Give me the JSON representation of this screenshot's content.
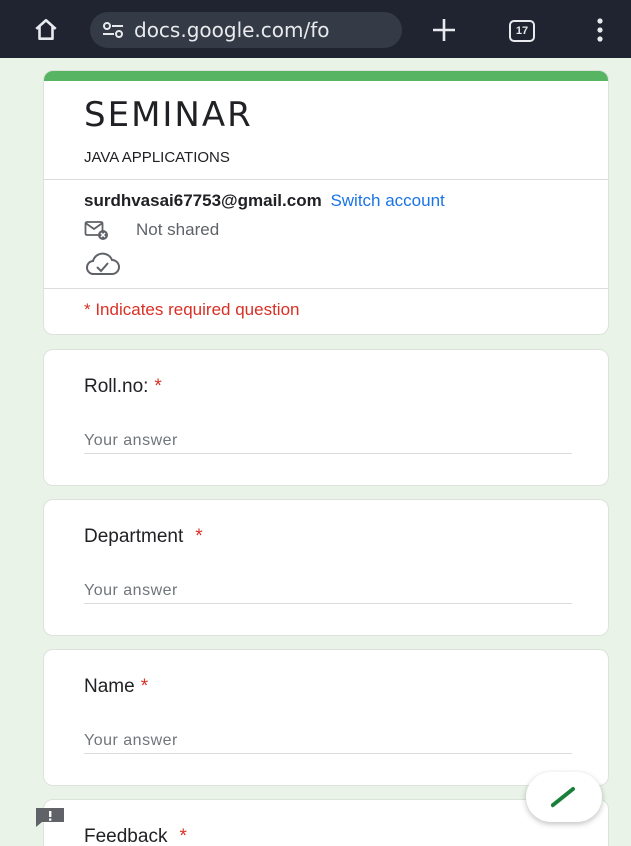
{
  "browser": {
    "url": "docs.google.com/fo",
    "tab_count": "17"
  },
  "form": {
    "title": "SEMINAR",
    "description": "JAVA APPLICATIONS",
    "account_email": "surdhvasai67753@gmail.com",
    "switch_account": "Switch account",
    "shared_status": "Not shared",
    "required_note": "* Indicates required question",
    "accent_color": "#56b463"
  },
  "questions": [
    {
      "label": "Roll.no:",
      "required": "*",
      "placeholder": "Your answer"
    },
    {
      "label": "Department",
      "required": "*",
      "placeholder": "Your answer"
    },
    {
      "label": "Name",
      "required": "*",
      "placeholder": "Your answer"
    },
    {
      "label": "Feedback",
      "required": "*"
    }
  ],
  "icons": {
    "home": "home-icon",
    "site_settings": "tune-icon",
    "new_tab": "plus-icon",
    "tabs": "tabs-icon",
    "menu": "more-vert-icon",
    "not_shared": "mail-off-icon",
    "cloud": "cloud-done-icon",
    "edit": "pencil-icon",
    "feedback": "feedback-icon"
  }
}
